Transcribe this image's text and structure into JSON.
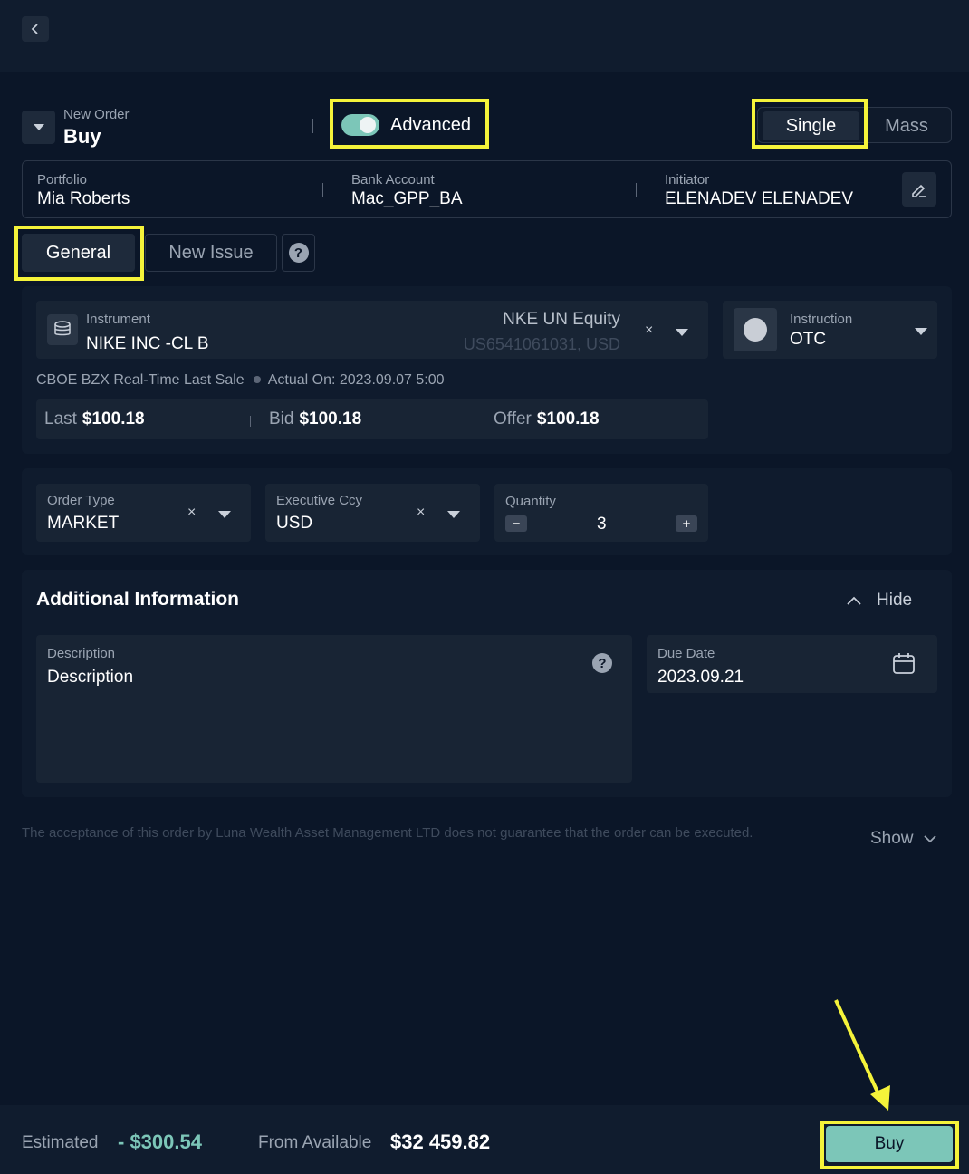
{
  "header": {
    "new_order_label": "New Order",
    "side": "Buy",
    "advanced_label": "Advanced",
    "advanced_enabled": true,
    "mode_options": [
      "Single",
      "Mass"
    ],
    "mode_selected": "Single"
  },
  "account": {
    "portfolio_label": "Portfolio",
    "portfolio_value": "Mia Roberts",
    "bank_label": "Bank Account",
    "bank_value": "Mac_GPP_BA",
    "initiator_label": "Initiator",
    "initiator_value": "ELENADEV ELENADEV"
  },
  "tabs": {
    "items": [
      "General",
      "New Issue"
    ],
    "selected": "General",
    "help_glyph": "?"
  },
  "instrument": {
    "label": "Instrument",
    "name": "NIKE INC -CL B",
    "ticker": "NKE UN Equity",
    "isin_ccy": "US6541061031, USD",
    "clear": "×",
    "feed": "CBOE BZX Real-Time Last Sale",
    "actual_on": "Actual On: 2023.09.07 5:00",
    "last_label": "Last",
    "last_value": "$100.18",
    "bid_label": "Bid",
    "bid_value": "$100.18",
    "offer_label": "Offer",
    "offer_value": "$100.18"
  },
  "instruction": {
    "label": "Instruction",
    "value": "OTC"
  },
  "order": {
    "type_label": "Order Type",
    "type_value": "MARKET",
    "ccy_label": "Executive Ccy",
    "ccy_value": "USD",
    "qty_label": "Quantity",
    "qty_value": "3",
    "minus": "−",
    "plus": "+",
    "clear": "×"
  },
  "additional": {
    "title": "Additional Information",
    "hide_label": "Hide",
    "description_label": "Description",
    "description_placeholder": "Description",
    "due_label": "Due Date",
    "due_value": "2023.09.21",
    "help_glyph": "?"
  },
  "disclaimer": {
    "text": "The acceptance of this order by Luna Wealth Asset Management LTD does not guarantee that the order can be executed.",
    "show_label": "Show"
  },
  "footer": {
    "estimated_label": "Estimated",
    "estimated_value": "- $300.54",
    "available_label": "From Available",
    "available_value": "$32 459.82",
    "buy_label": "Buy"
  },
  "colors": {
    "background": "#0b1628",
    "accent": "#7cc6b8",
    "highlight": "#f5f33a"
  }
}
